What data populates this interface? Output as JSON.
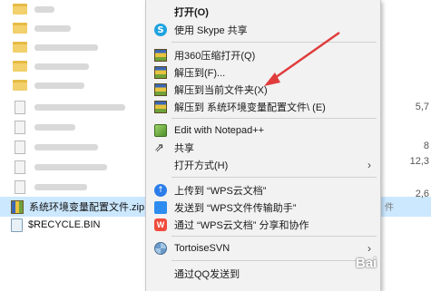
{
  "explorer": {
    "selected_file": "系统环境变量配置文件.zip",
    "recycle_bin": "$RECYCLE.BIN",
    "right_column": [
      "5,7",
      "8",
      "12,3",
      "2,6"
    ],
    "selected_row_tail": "件"
  },
  "context_menu": {
    "items": [
      {
        "label": "打开(O)",
        "icon": "none",
        "bold": true
      },
      {
        "label": "使用 Skype 共享",
        "icon": "skype-icon"
      },
      {
        "label": "用360压缩打开(Q)",
        "icon": "archive-360-icon"
      },
      {
        "label": "解压到(F)...",
        "icon": "archive-360-icon"
      },
      {
        "label": "解压到当前文件夹(X)",
        "icon": "archive-360-icon"
      },
      {
        "label": "解压到 系统环境变量配置文件\\ (E)",
        "icon": "archive-360-icon"
      },
      {
        "label": "Edit with Notepad++",
        "icon": "notepad-plus-plus-icon"
      },
      {
        "label": "共享",
        "icon": "share-icon"
      },
      {
        "label": "打开方式(H)",
        "icon": "none",
        "submenu": true
      },
      {
        "label": "上传到 “WPS云文档”",
        "icon": "wps-cloud-upload-icon"
      },
      {
        "label": "发送到 “WPS文件传输助手”",
        "icon": "wps-send-icon"
      },
      {
        "label": "通过 “WPS云文档” 分享和协作",
        "icon": "wps-share-icon"
      },
      {
        "label": "TortoiseSVN",
        "icon": "tortoise-svn-icon",
        "submenu": true
      },
      {
        "label": "通过QQ发送到",
        "icon": "none"
      }
    ]
  },
  "watermark": "Bai",
  "colors": {
    "menu_bg": "#f2f2f2",
    "selection": "#cce8ff",
    "arrow": "#e03c3c",
    "folder": "#f2d06b"
  }
}
